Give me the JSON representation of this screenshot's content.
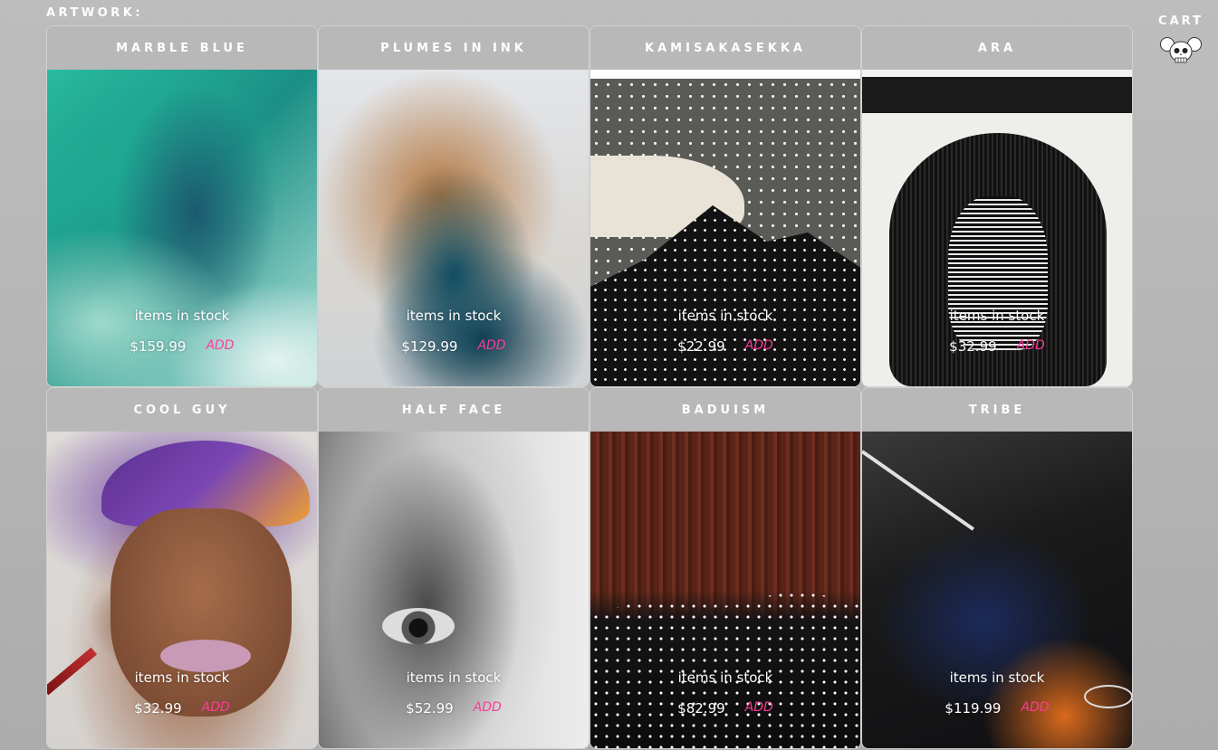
{
  "header": {
    "section_title": "ARTWORK:"
  },
  "cart": {
    "label": "CART",
    "icon": "skull-mouse-icon"
  },
  "accent_color": "#ff3b9a",
  "products": [
    {
      "title": "MARBLE BLUE",
      "stock_text": "items in stock",
      "price": "$159.99",
      "add_label": "ADD"
    },
    {
      "title": "PLUMES IN INK",
      "stock_text": "items in stock",
      "price": "$129.99",
      "add_label": "ADD"
    },
    {
      "title": "KAMISAKASEKKA",
      "stock_text": "items in stock",
      "price": "$22.99",
      "add_label": "ADD"
    },
    {
      "title": "ARA",
      "stock_text": "items in stock",
      "price": "$32.99",
      "add_label": "ADD"
    },
    {
      "title": "COOL GUY",
      "stock_text": "items in stock",
      "price": "$32.99",
      "add_label": "ADD"
    },
    {
      "title": "HALF FACE",
      "stock_text": "items in stock",
      "price": "$52.99",
      "add_label": "ADD"
    },
    {
      "title": "BADUISM",
      "stock_text": "items in stock",
      "price": "$82.99",
      "add_label": "ADD"
    },
    {
      "title": "TRIBE",
      "stock_text": "items in stock",
      "price": "$119.99",
      "add_label": "ADD"
    }
  ]
}
